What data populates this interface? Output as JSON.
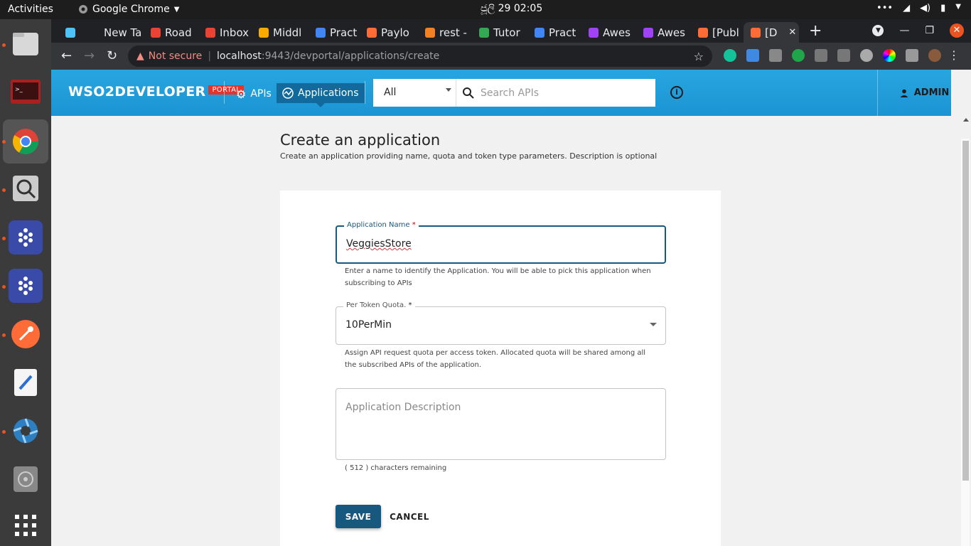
{
  "os": {
    "activities": "Activities",
    "app_name": "Google Chrome",
    "clock": "ජූලි 29  02:05"
  },
  "tabs": [
    {
      "label": "",
      "color": "#4fc3f7"
    },
    {
      "label": "New Tab",
      "color": "#202124"
    },
    {
      "label": "Road",
      "color": "#ea4335"
    },
    {
      "label": "Inbox",
      "color": "#ea4335"
    },
    {
      "label": "Middl",
      "color": "#f9ab00"
    },
    {
      "label": "Pract",
      "color": "#4285f4"
    },
    {
      "label": "Paylo",
      "color": "#ff6c37"
    },
    {
      "label": "rest -",
      "color": "#f48024"
    },
    {
      "label": "Tutor",
      "color": "#34a853"
    },
    {
      "label": "Pract",
      "color": "#4285f4"
    },
    {
      "label": "Awes",
      "color": "#a142f4"
    },
    {
      "label": "Awes",
      "color": "#a142f4"
    },
    {
      "label": "[Publ",
      "color": "#ff6c37"
    },
    {
      "label": "[D",
      "color": "#ff6c37",
      "active": true
    }
  ],
  "address": {
    "warning": "Not secure",
    "host": "localhost",
    "path": ":9443/devportal/applications/create"
  },
  "portal": {
    "logo_text": "WSO2DEVELOPER",
    "logo_badge": "PORTAL",
    "nav_apis": "APIs",
    "nav_applications": "Applications",
    "filter_value": "All",
    "search_placeholder": "Search APIs",
    "info_icon": "i",
    "user": "ADMIN"
  },
  "form": {
    "title": "Create an application",
    "subtitle": "Create an application providing name, quota and token type parameters. Description is optional",
    "app_name_label": "Application Name",
    "app_name_value": "VeggiesStore",
    "app_name_helper": "Enter a name to identify the Application. You will be able to pick this application when subscribing to APIs",
    "quota_label": "Per Token Quota.",
    "quota_value": "10PerMin",
    "quota_helper": "Assign API request quota per access token. Allocated quota will be shared among all the subscribed APIs of the application.",
    "description_placeholder": "Application Description",
    "chars_remaining": "( 512 ) characters remaining",
    "required_mark": "*",
    "save_label": "SAVE",
    "cancel_label": "CANCEL"
  },
  "colors": {
    "header": "#1c94d3",
    "primary": "#17587f",
    "accent": "#e8332a"
  }
}
